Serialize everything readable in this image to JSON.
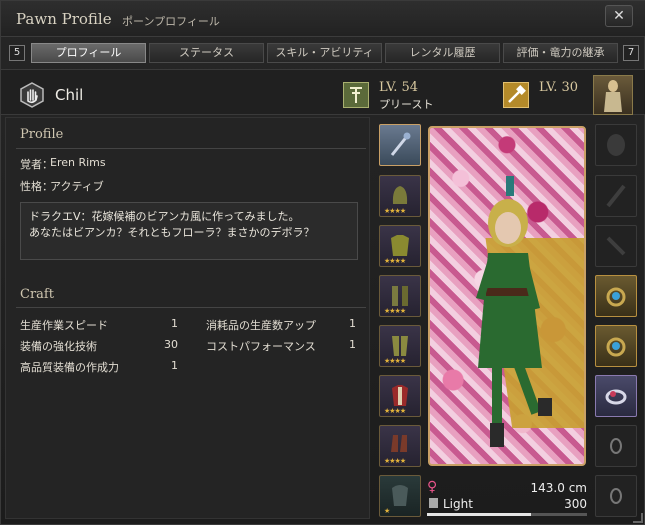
{
  "window": {
    "title_en": "Pawn Profile",
    "title_jp": "ポーンプロフィール",
    "close_label": "✕"
  },
  "tabs": {
    "prev_key": "5",
    "next_key": "7",
    "items": [
      {
        "label": "プロフィール",
        "active": true
      },
      {
        "label": "ステータス",
        "active": false
      },
      {
        "label": "スキル・アビリティ",
        "active": false
      },
      {
        "label": "レンタル履歴",
        "active": false
      },
      {
        "label": "評価・竜力の継承",
        "active": false
      }
    ]
  },
  "pawn": {
    "name": "Chil",
    "icon": "hand-shield-icon"
  },
  "vocation": {
    "level": "LV. 54",
    "name": "プリースト",
    "icon": "priest-staff-icon"
  },
  "weapon_skill": {
    "level": "LV. 30",
    "icon": "hammer-icon"
  },
  "profile": {
    "section_title": "Profile",
    "master_label": "覚者：",
    "master_value": "Eren Rims",
    "personality_label": "性格：",
    "personality_value": "アクティブ",
    "comment_line1": "ドラクエV：花嫁候補のビアンカ風に作ってみました。",
    "comment_line2": "あなたはビアンカ？それともフローラ？まさかのデボラ？"
  },
  "craft": {
    "section_title": "Craft",
    "items": [
      {
        "label": "生産作業スピード",
        "value": "1"
      },
      {
        "label": "装備の強化技術",
        "value": "30"
      },
      {
        "label": "高品質装備の作成力",
        "value": "1"
      },
      {
        "label": "消耗品の生産数アップ",
        "value": "1"
      },
      {
        "label": "コストパフォーマンス",
        "value": "1"
      }
    ]
  },
  "equipment_left": [
    {
      "icon": "staff-icon",
      "stars": ""
    },
    {
      "icon": "head-armor-icon",
      "stars": "★★★★"
    },
    {
      "icon": "body-armor-icon",
      "stars": "★★★★"
    },
    {
      "icon": "arm-armor-icon",
      "stars": "★★★★"
    },
    {
      "icon": "leg-armor-icon",
      "stars": "★★★★"
    },
    {
      "icon": "clothing-icon",
      "stars": "★★★★"
    },
    {
      "icon": "boots-icon",
      "stars": "★★★★"
    },
    {
      "icon": "cloak-icon",
      "stars": "★"
    }
  ],
  "equipment_right": [
    {
      "icon": "shield-slot-icon",
      "empty": true
    },
    {
      "icon": "bow-slot-icon",
      "empty": true
    },
    {
      "icon": "sword-slot-icon",
      "empty": true
    },
    {
      "icon": "ring-gem-icon",
      "empty": false
    },
    {
      "icon": "ring-gem-icon",
      "empty": false
    },
    {
      "icon": "ring-gem-icon",
      "empty": false
    },
    {
      "icon": "ring-slot-icon",
      "empty": true
    },
    {
      "icon": "ring-slot-icon",
      "empty": true
    }
  ],
  "body": {
    "gender_symbol": "♀",
    "height": "143.0 cm",
    "weight_label": "Light",
    "weight_value": "300",
    "weight_fraction": 0.65
  },
  "colors": {
    "accent_gold": "#c9a066",
    "gender_female": "#e8548a",
    "star": "#e2b23a"
  }
}
